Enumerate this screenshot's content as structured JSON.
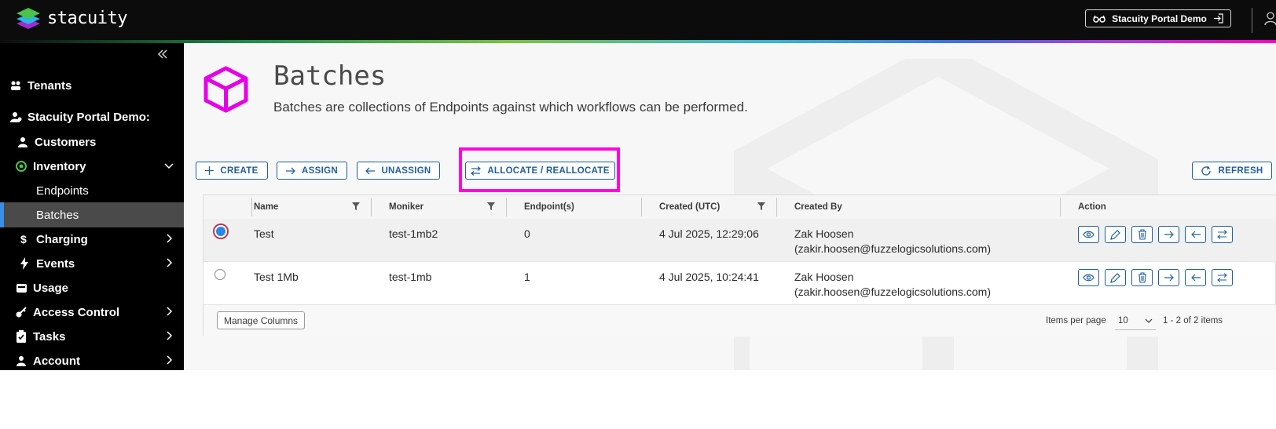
{
  "app": {
    "logo_text": "stacuity"
  },
  "header": {
    "tenant_button": "Stacuity Portal Demo"
  },
  "sidebar": {
    "items": [
      {
        "label": "Tenants"
      },
      {
        "label": "Stacuity Portal Demo:"
      },
      {
        "label": "Customers"
      },
      {
        "label": "Inventory"
      },
      {
        "label": "Endpoints"
      },
      {
        "label": "Batches"
      },
      {
        "label": "Charging"
      },
      {
        "label": "Events"
      },
      {
        "label": "Usage"
      },
      {
        "label": "Access Control"
      },
      {
        "label": "Tasks"
      },
      {
        "label": "Account"
      }
    ]
  },
  "page": {
    "title": "Batches",
    "subtitle": "Batches are collections of Endpoints against which workflows can be performed."
  },
  "toolbar": {
    "create": "CREATE",
    "assign": "ASSIGN",
    "unassign": "UNASSIGN",
    "allocate": "ALLOCATE / REALLOCATE",
    "refresh": "REFRESH"
  },
  "table": {
    "columns": [
      "Name",
      "Moniker",
      "Endpoint(s)",
      "Created (UTC)",
      "Created By",
      "Action"
    ],
    "rows": [
      {
        "name": "Test",
        "moniker": "test-1mb2",
        "endpoints": "0",
        "created": "4 Jul 2025, 12:29:06",
        "created_by_name": "Zak Hoosen",
        "created_by_email": "(zakir.hoosen@fuzzelogicsolutions.com)",
        "selected": true
      },
      {
        "name": "Test 1Mb",
        "moniker": "test-1mb",
        "endpoints": "1",
        "created": "4 Jul 2025, 10:24:41",
        "created_by_name": "Zak Hoosen",
        "created_by_email": "(zakir.hoosen@fuzzelogicsolutions.com)",
        "selected": false
      }
    ]
  },
  "footer": {
    "manage_columns": "Manage Columns",
    "items_per_page_label": "Items per page",
    "items_per_page_value": "10",
    "pagination_info": "1 - 2 of 2 items"
  },
  "colors": {
    "accent": "#1f5f9e",
    "highlight": "#ff00e0",
    "cube": "#e600e6"
  }
}
